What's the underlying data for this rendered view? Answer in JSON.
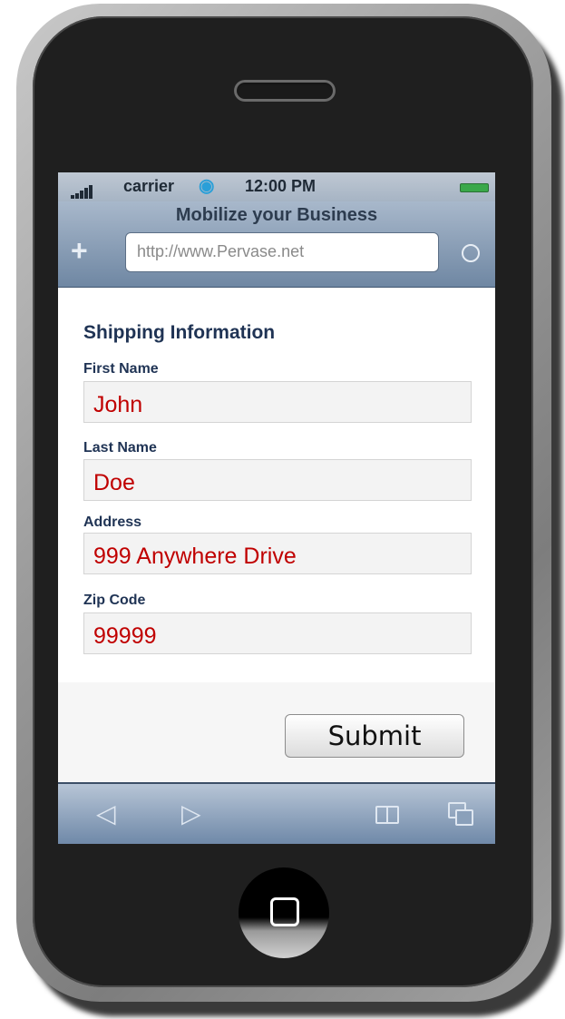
{
  "status_bar": {
    "carrier": "carrier",
    "time": "12:00 PM"
  },
  "browser": {
    "page_title": "Mobilize your Business",
    "url": "http://www.Pervase.net"
  },
  "form": {
    "section_title": "Shipping Information",
    "fields": [
      {
        "label": "First Name",
        "value": "John"
      },
      {
        "label": "Last Name",
        "value": "Doe"
      },
      {
        "label": "Address",
        "value": "999 Anywhere Drive"
      },
      {
        "label": "Zip Code",
        "value": "99999"
      }
    ],
    "submit_label": "Submit"
  },
  "colors": {
    "field_value": "#c00000",
    "label": "#1f3354",
    "battery": "#3aa84a"
  },
  "icons": [
    "signal-bars-icon",
    "wifi-icon",
    "battery-icon",
    "add-icon",
    "reload-icon",
    "back-icon",
    "forward-icon",
    "bookmarks-icon",
    "pages-icon",
    "home-button-icon"
  ]
}
